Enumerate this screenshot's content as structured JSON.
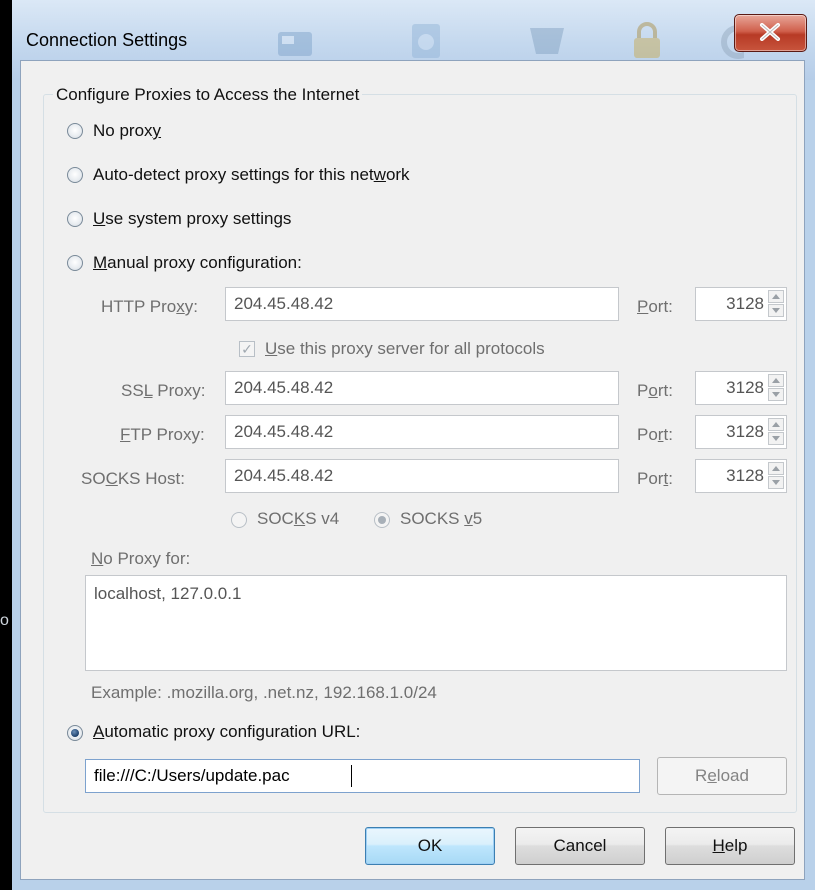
{
  "window": {
    "title": "Connection Settings",
    "close_label": "X"
  },
  "group": {
    "title": "Configure Proxies to Access the Internet"
  },
  "radios": {
    "no_proxy": {
      "label_pre": "No prox",
      "key": "y",
      "label_post": ""
    },
    "auto_detect": {
      "label_pre": "Auto-detect proxy settings for this net",
      "key": "w",
      "label_post": "ork"
    },
    "system": {
      "label_pre": "",
      "key": "U",
      "label_post": "se system proxy settings"
    },
    "manual": {
      "label_pre": "",
      "key": "M",
      "label_post": "anual proxy configuration:"
    },
    "auto_url": {
      "label_pre": "",
      "key": "A",
      "label_post": "utomatic proxy configuration URL:"
    }
  },
  "selected_mode": "auto_url",
  "http": {
    "label_pre": "HTTP Pro",
    "key": "x",
    "label_post": "y:",
    "value": "204.45.48.42",
    "port_label_key": "P",
    "port_label_post": "ort:",
    "port": "3128"
  },
  "share": {
    "label_pre": "",
    "key": "U",
    "label_post": "se this proxy server for all protocols",
    "checked_mark": "✓"
  },
  "ssl": {
    "label_pre": "SS",
    "key": "L",
    "label_post": " Proxy:",
    "value": "204.45.48.42",
    "port_label_pre": "P",
    "port_label_key": "o",
    "port_label_post": "rt:",
    "port": "3128"
  },
  "ftp": {
    "label_pre": "",
    "key": "F",
    "label_post": "TP Proxy:",
    "value": "204.45.48.42",
    "port_label_pre": "Po",
    "port_label_key": "r",
    "port_label_post": "t:",
    "port": "3128"
  },
  "socks": {
    "label_pre": "SO",
    "key": "C",
    "label_post": "KS Host:",
    "value": "204.45.48.42",
    "port_label_pre": "Por",
    "port_label_key": "t",
    "port_label_post": ":",
    "port": "3128"
  },
  "socks_v4": {
    "label_pre": "SOC",
    "key": "K",
    "label_post": "S v4"
  },
  "socks_v5": {
    "label_pre": "SOCKS ",
    "key": "v",
    "label_post": "5"
  },
  "no_proxy_for": {
    "label_key": "N",
    "label_post": "o Proxy for:",
    "value": "localhost, 127.0.0.1",
    "example": "Example: .mozilla.org, .net.nz, 192.168.1.0/24"
  },
  "auto_url": {
    "value": "file:///C:/Users/update.pac",
    "reload_pre": "R",
    "reload_key": "e",
    "reload_post": "load"
  },
  "buttons": {
    "ok": "OK",
    "cancel": "Cancel",
    "help_key": "H",
    "help_post": "elp"
  },
  "side_glyph": "o"
}
